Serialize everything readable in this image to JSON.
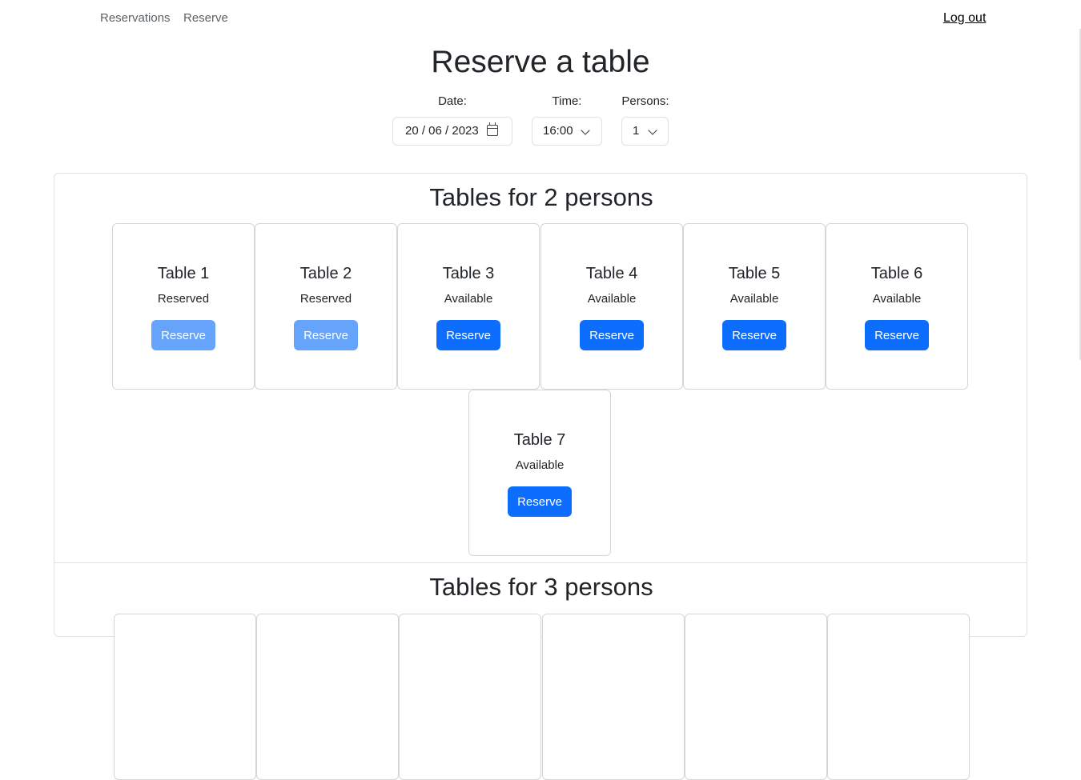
{
  "nav": {
    "reservations": "Reservations",
    "reserve": "Reserve",
    "logout": "Log out"
  },
  "page_title": "Reserve a table",
  "filters": {
    "date": {
      "label": "Date:",
      "value": "20 / 06 / 2023"
    },
    "time": {
      "label": "Time:",
      "value": "16:00"
    },
    "persons": {
      "label": "Persons:",
      "value": "1"
    }
  },
  "sections": [
    {
      "title": "Tables for 2 persons",
      "tables": [
        {
          "name": "Table 1",
          "status": "Reserved",
          "button": "Reserve",
          "enabled": false
        },
        {
          "name": "Table 2",
          "status": "Reserved",
          "button": "Reserve",
          "enabled": false
        },
        {
          "name": "Table 3",
          "status": "Available",
          "button": "Reserve",
          "enabled": true
        },
        {
          "name": "Table 4",
          "status": "Available",
          "button": "Reserve",
          "enabled": true
        },
        {
          "name": "Table 5",
          "status": "Available",
          "button": "Reserve",
          "enabled": true
        },
        {
          "name": "Table 6",
          "status": "Available",
          "button": "Reserve",
          "enabled": true
        },
        {
          "name": "Table 7",
          "status": "Available",
          "button": "Reserve",
          "enabled": true
        }
      ]
    },
    {
      "title": "Tables for 3 persons",
      "tables": []
    }
  ],
  "colors": {
    "primary": "#0d6efd",
    "primary_disabled": "#66a3fb",
    "border": "#dee2e6",
    "text": "#212529"
  },
  "icons": [
    "calendar-icon",
    "chevron-down-icon"
  ]
}
